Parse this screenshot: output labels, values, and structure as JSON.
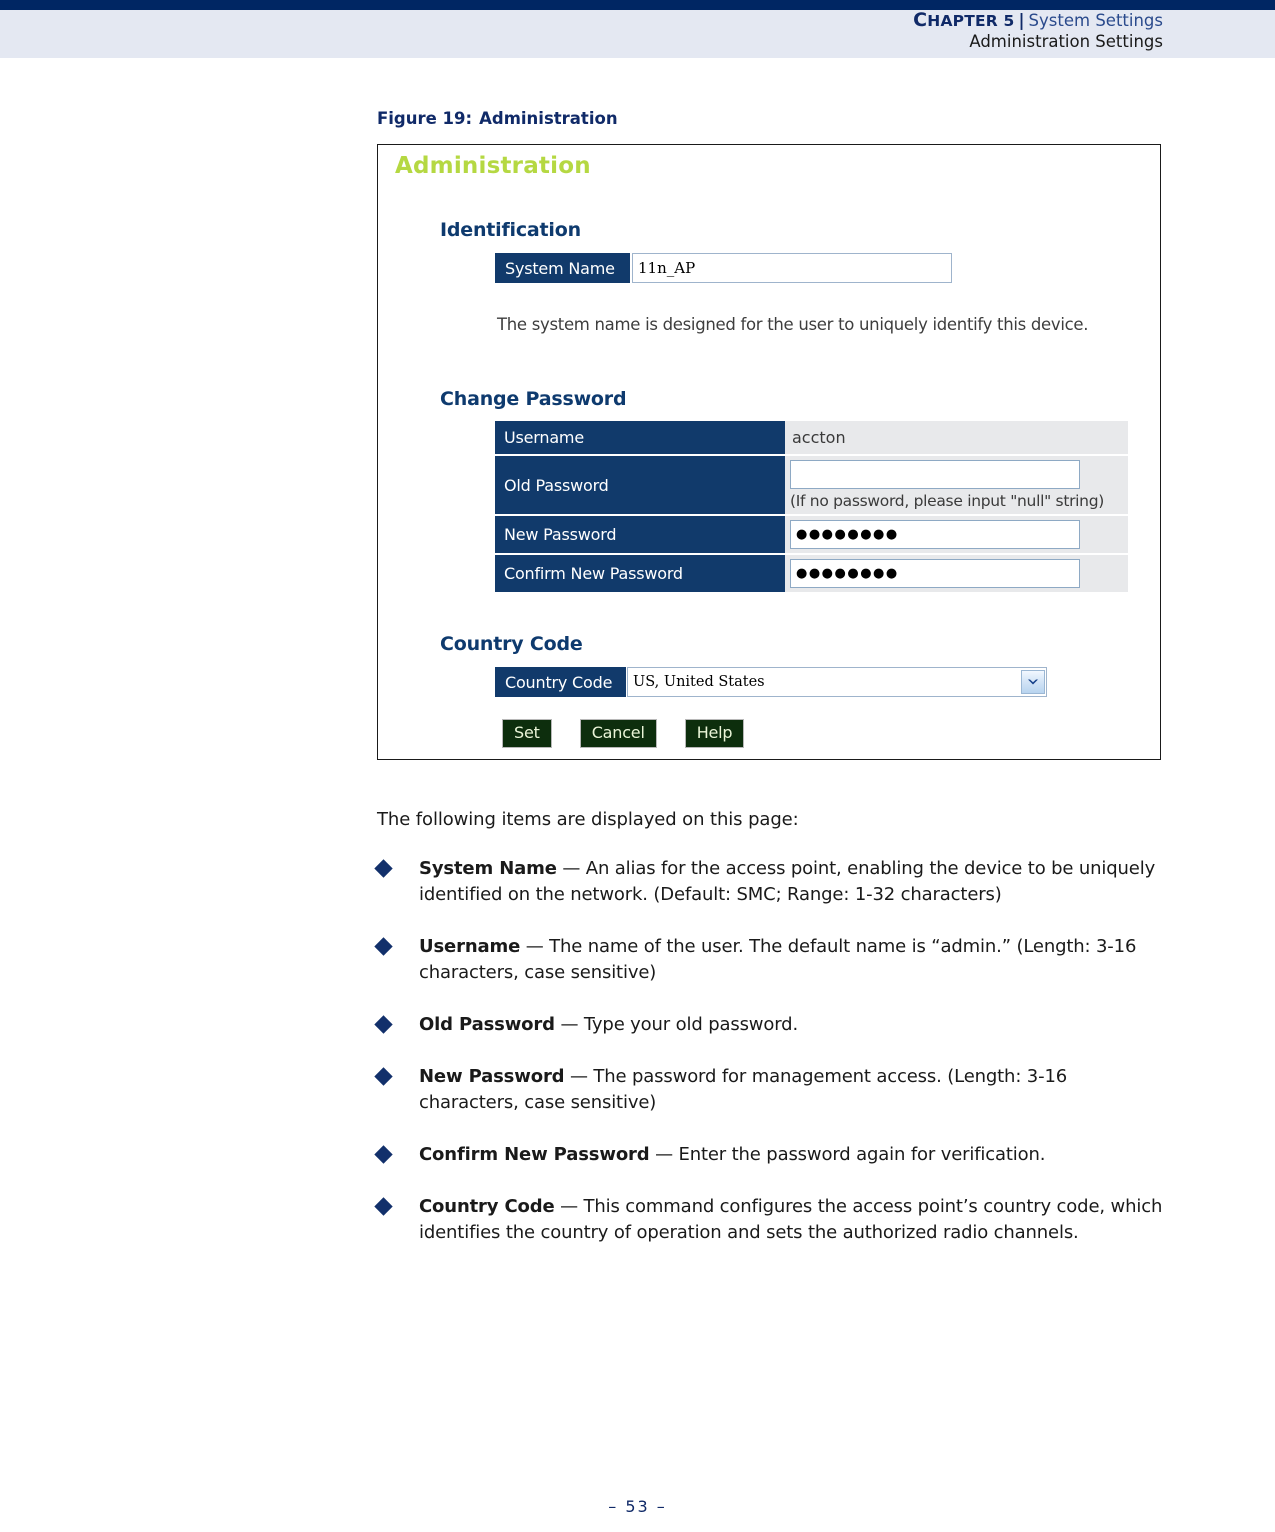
{
  "header": {
    "chapter_label": "Chapter 5",
    "chapter_first": "C",
    "chapter_rest": "HAPTER 5",
    "separator": "|",
    "section": "System Settings",
    "subsection": "Administration Settings"
  },
  "figure": {
    "label": "Figure 19:",
    "title": "Administration"
  },
  "screenshot": {
    "page_title": "Administration",
    "identification": {
      "heading": "Identification",
      "system_name_label": "System Name",
      "system_name_value": "11n_AP",
      "help_text": "The system name is designed for the user to uniquely identify this device."
    },
    "change_password": {
      "heading": "Change Password",
      "rows": [
        {
          "label": "Username",
          "type": "text",
          "value": "accton",
          "hint": ""
        },
        {
          "label": "Old Password",
          "type": "input",
          "value": "",
          "hint": "(If no password, please input \"null\" string)"
        },
        {
          "label": "New Password",
          "type": "input",
          "value": "●●●●●●●●",
          "hint": ""
        },
        {
          "label": "Confirm New Password",
          "type": "input",
          "value": "●●●●●●●●",
          "hint": ""
        }
      ]
    },
    "country_code": {
      "heading": "Country Code",
      "label": "Country Code",
      "selected": "US, United States"
    },
    "buttons": [
      {
        "label": "Set"
      },
      {
        "label": "Cancel"
      },
      {
        "label": "Help"
      }
    ],
    "colors": {
      "title_green": "#b5d842",
      "label_navy": "#113a6b",
      "heading_navy": "#0e3a6e",
      "button_green": "#0d2e0d",
      "button_text": "#eaf5d8",
      "value_cell_gray": "#e8e9eb"
    }
  },
  "body": {
    "intro": "The following items are displayed on this page:",
    "bullets": [
      {
        "term": "System Name",
        "description": " — An alias for the access point, enabling the device to be uniquely identified on the network. (Default: SMC; Range: 1-32 characters)"
      },
      {
        "term": "Username",
        "description": " — The name of the user. The default name is “admin.” (Length: 3-16 characters, case sensitive)"
      },
      {
        "term": "Old Password",
        "description": " — Type your old password."
      },
      {
        "term": "New Password",
        "description": " — The password for management access. (Length: 3-16 characters, case sensitive)"
      },
      {
        "term": "Confirm New Password",
        "description": " — Enter the password again for verification."
      },
      {
        "term": "Country Code",
        "description": " — This command configures the access point’s country code, which identifies the country of operation and sets the authorized radio channels."
      }
    ]
  },
  "footer": {
    "page_number": "–  53  –"
  }
}
